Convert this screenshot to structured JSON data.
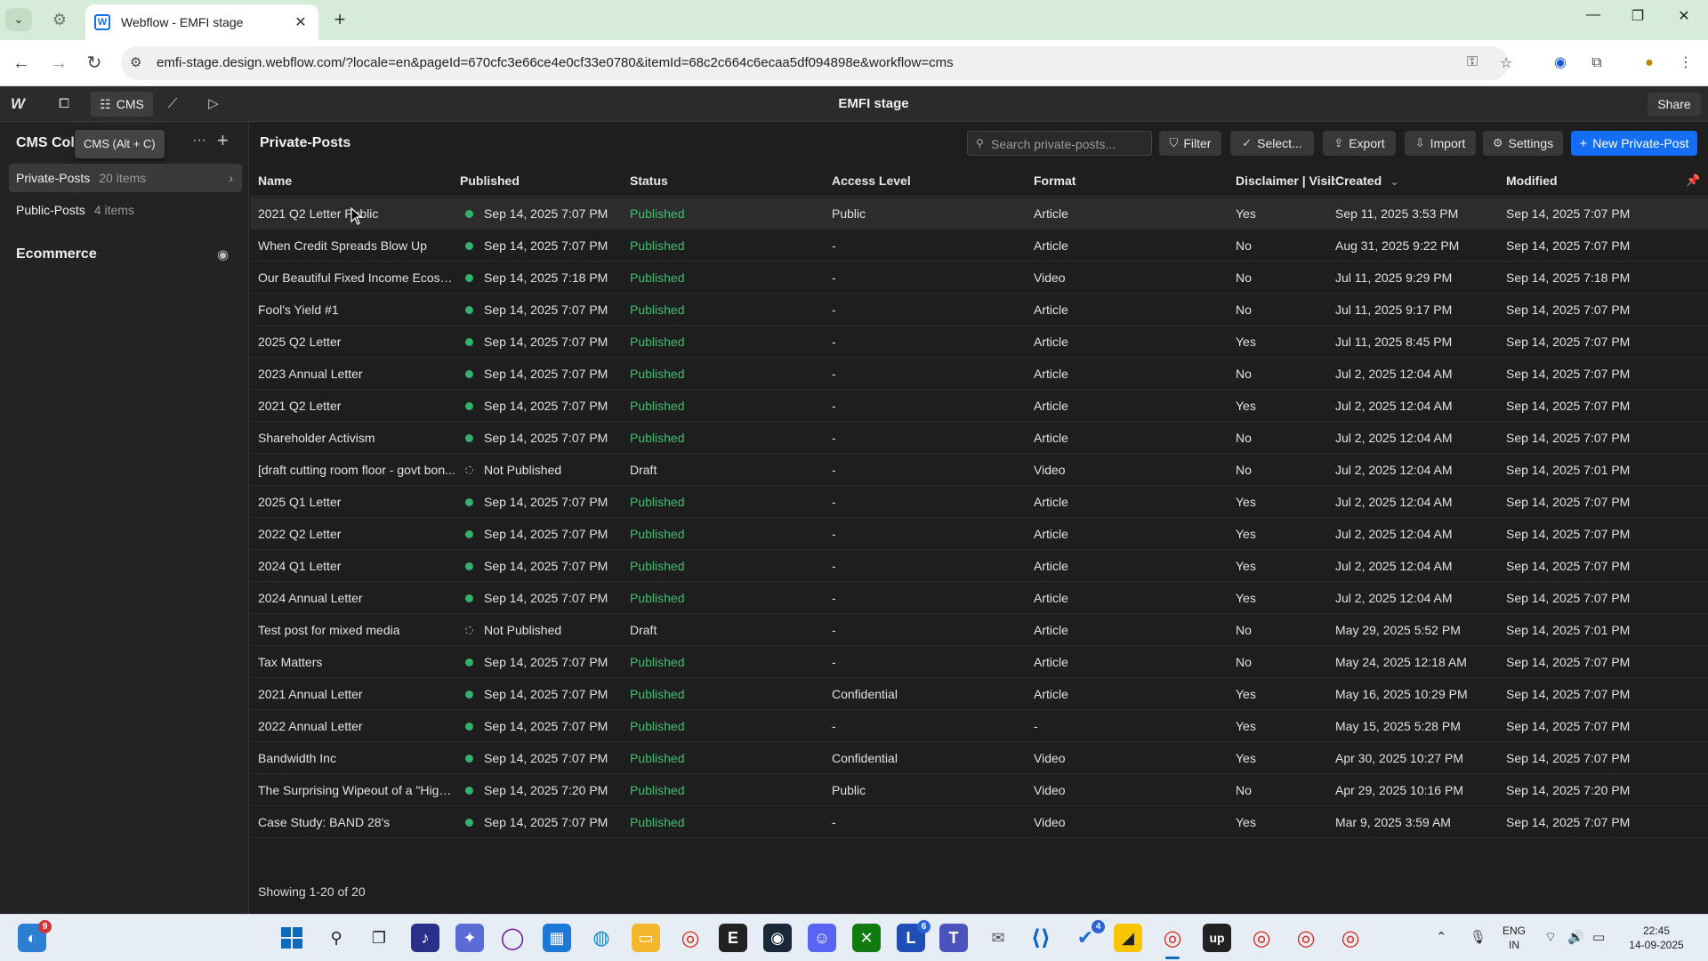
{
  "browser": {
    "tab_title": "Webflow - EMFI stage",
    "url": "emfi-stage.design.webflow.com/?locale=en&pageId=670cfc3e66ce4e0cf33e0780&itemId=68c2c664c6ecaa5df094898e&workflow=cms"
  },
  "webflow": {
    "cms_label": "CMS",
    "site_name": "EMFI stage",
    "share_label": "Share"
  },
  "sidebar": {
    "title": "CMS Coll",
    "tooltip": "CMS (Alt + C)",
    "collections": [
      {
        "name": "Private-Posts",
        "count": "20 items"
      },
      {
        "name": "Public-Posts",
        "count": "4 items"
      }
    ],
    "ecommerce_label": "Ecommerce"
  },
  "main": {
    "collection_title": "Private-Posts",
    "search_placeholder": "Search private-posts...",
    "buttons": {
      "filter": "Filter",
      "select": "Select...",
      "export": "Export",
      "import": "Import",
      "settings": "Settings",
      "new_item": "New Private-Post"
    },
    "columns": {
      "name": "Name",
      "published": "Published",
      "status": "Status",
      "access": "Access Level",
      "format": "Format",
      "disclaimer": "Disclaimer | Visibi",
      "created": "Created",
      "modified": "Modified"
    },
    "rows": [
      {
        "name": "2021 Q2 Letter Public",
        "published": "Sep 14, 2025 7:07 PM",
        "status": "Published",
        "access": "Public",
        "format": "Article",
        "disclaimer": "Yes",
        "created": "Sep 11, 2025 3:53 PM",
        "modified": "Sep 14, 2025 7:07 PM"
      },
      {
        "name": "When Credit Spreads Blow Up",
        "published": "Sep 14, 2025 7:07 PM",
        "status": "Published",
        "access": "-",
        "format": "Article",
        "disclaimer": "No",
        "created": "Aug 31, 2025 9:22 PM",
        "modified": "Sep 14, 2025 7:07 PM"
      },
      {
        "name": "Our Beautiful Fixed Income Ecosyst...",
        "published": "Sep 14, 2025 7:18 PM",
        "status": "Published",
        "access": "-",
        "format": "Video",
        "disclaimer": "No",
        "created": "Jul 11, 2025 9:29 PM",
        "modified": "Sep 14, 2025 7:18 PM"
      },
      {
        "name": "Fool's Yield #1",
        "published": "Sep 14, 2025 7:07 PM",
        "status": "Published",
        "access": "-",
        "format": "Article",
        "disclaimer": "No",
        "created": "Jul 11, 2025 9:17 PM",
        "modified": "Sep 14, 2025 7:07 PM"
      },
      {
        "name": "2025 Q2 Letter",
        "published": "Sep 14, 2025 7:07 PM",
        "status": "Published",
        "access": "-",
        "format": "Article",
        "disclaimer": "Yes",
        "created": "Jul 11, 2025 8:45 PM",
        "modified": "Sep 14, 2025 7:07 PM"
      },
      {
        "name": "2023 Annual Letter",
        "published": "Sep 14, 2025 7:07 PM",
        "status": "Published",
        "access": "-",
        "format": "Article",
        "disclaimer": "No",
        "created": "Jul 2, 2025 12:04 AM",
        "modified": "Sep 14, 2025 7:07 PM"
      },
      {
        "name": "2021 Q2 Letter",
        "published": "Sep 14, 2025 7:07 PM",
        "status": "Published",
        "access": "-",
        "format": "Article",
        "disclaimer": "Yes",
        "created": "Jul 2, 2025 12:04 AM",
        "modified": "Sep 14, 2025 7:07 PM"
      },
      {
        "name": "Shareholder Activism",
        "published": "Sep 14, 2025 7:07 PM",
        "status": "Published",
        "access": "-",
        "format": "Article",
        "disclaimer": "No",
        "created": "Jul 2, 2025 12:04 AM",
        "modified": "Sep 14, 2025 7:07 PM"
      },
      {
        "name": "[draft cutting room floor - govt bon...",
        "published": "Not Published",
        "status": "Draft",
        "access": "-",
        "format": "Video",
        "disclaimer": "No",
        "created": "Jul 2, 2025 12:04 AM",
        "modified": "Sep 14, 2025 7:01 PM"
      },
      {
        "name": "2025 Q1 Letter",
        "published": "Sep 14, 2025 7:07 PM",
        "status": "Published",
        "access": "-",
        "format": "Article",
        "disclaimer": "Yes",
        "created": "Jul 2, 2025 12:04 AM",
        "modified": "Sep 14, 2025 7:07 PM"
      },
      {
        "name": "2022 Q2 Letter",
        "published": "Sep 14, 2025 7:07 PM",
        "status": "Published",
        "access": "-",
        "format": "Article",
        "disclaimer": "Yes",
        "created": "Jul 2, 2025 12:04 AM",
        "modified": "Sep 14, 2025 7:07 PM"
      },
      {
        "name": "2024 Q1 Letter",
        "published": "Sep 14, 2025 7:07 PM",
        "status": "Published",
        "access": "-",
        "format": "Article",
        "disclaimer": "Yes",
        "created": "Jul 2, 2025 12:04 AM",
        "modified": "Sep 14, 2025 7:07 PM"
      },
      {
        "name": "2024 Annual Letter",
        "published": "Sep 14, 2025 7:07 PM",
        "status": "Published",
        "access": "-",
        "format": "Article",
        "disclaimer": "Yes",
        "created": "Jul 2, 2025 12:04 AM",
        "modified": "Sep 14, 2025 7:07 PM"
      },
      {
        "name": "Test post for mixed media",
        "published": "Not Published",
        "status": "Draft",
        "access": "-",
        "format": "Article",
        "disclaimer": "No",
        "created": "May 29, 2025 5:52 PM",
        "modified": "Sep 14, 2025 7:01 PM"
      },
      {
        "name": "Tax Matters",
        "published": "Sep 14, 2025 7:07 PM",
        "status": "Published",
        "access": "-",
        "format": "Article",
        "disclaimer": "No",
        "created": "May 24, 2025 12:18 AM",
        "modified": "Sep 14, 2025 7:07 PM"
      },
      {
        "name": "2021 Annual Letter",
        "published": "Sep 14, 2025 7:07 PM",
        "status": "Published",
        "access": "Confidential",
        "format": "Article",
        "disclaimer": "Yes",
        "created": "May 16, 2025 10:29 PM",
        "modified": "Sep 14, 2025 7:07 PM"
      },
      {
        "name": "2022 Annual Letter",
        "published": "Sep 14, 2025 7:07 PM",
        "status": "Published",
        "access": "-",
        "format": "-",
        "disclaimer": "Yes",
        "created": "May 15, 2025 5:28 PM",
        "modified": "Sep 14, 2025 7:07 PM"
      },
      {
        "name": "Bandwidth Inc",
        "published": "Sep 14, 2025 7:07 PM",
        "status": "Published",
        "access": "Confidential",
        "format": "Video",
        "disclaimer": "Yes",
        "created": "Apr 30, 2025 10:27 PM",
        "modified": "Sep 14, 2025 7:07 PM"
      },
      {
        "name": "The Surprising Wipeout of a \"High Q...",
        "published": "Sep 14, 2025 7:20 PM",
        "status": "Published",
        "access": "Public",
        "format": "Video",
        "disclaimer": "No",
        "created": "Apr 29, 2025 10:16 PM",
        "modified": "Sep 14, 2025 7:20 PM"
      },
      {
        "name": "Case Study: BAND 28's",
        "published": "Sep 14, 2025 7:07 PM",
        "status": "Published",
        "access": "-",
        "format": "Video",
        "disclaimer": "Yes",
        "created": "Mar 9, 2025 3:59 AM",
        "modified": "Sep 14, 2025 7:07 PM"
      }
    ],
    "footer": "Showing 1-20 of 20"
  },
  "taskbar": {
    "notification_count": "9",
    "badges": {
      "l_app": "6",
      "vscode_app": "4"
    },
    "language": "ENG",
    "region": "IN",
    "time": "22:45",
    "date": "14-09-2025"
  },
  "colors": {
    "accent": "#146ef5",
    "published_green": "#38c172",
    "tab_strip": "#d6ecd9"
  }
}
